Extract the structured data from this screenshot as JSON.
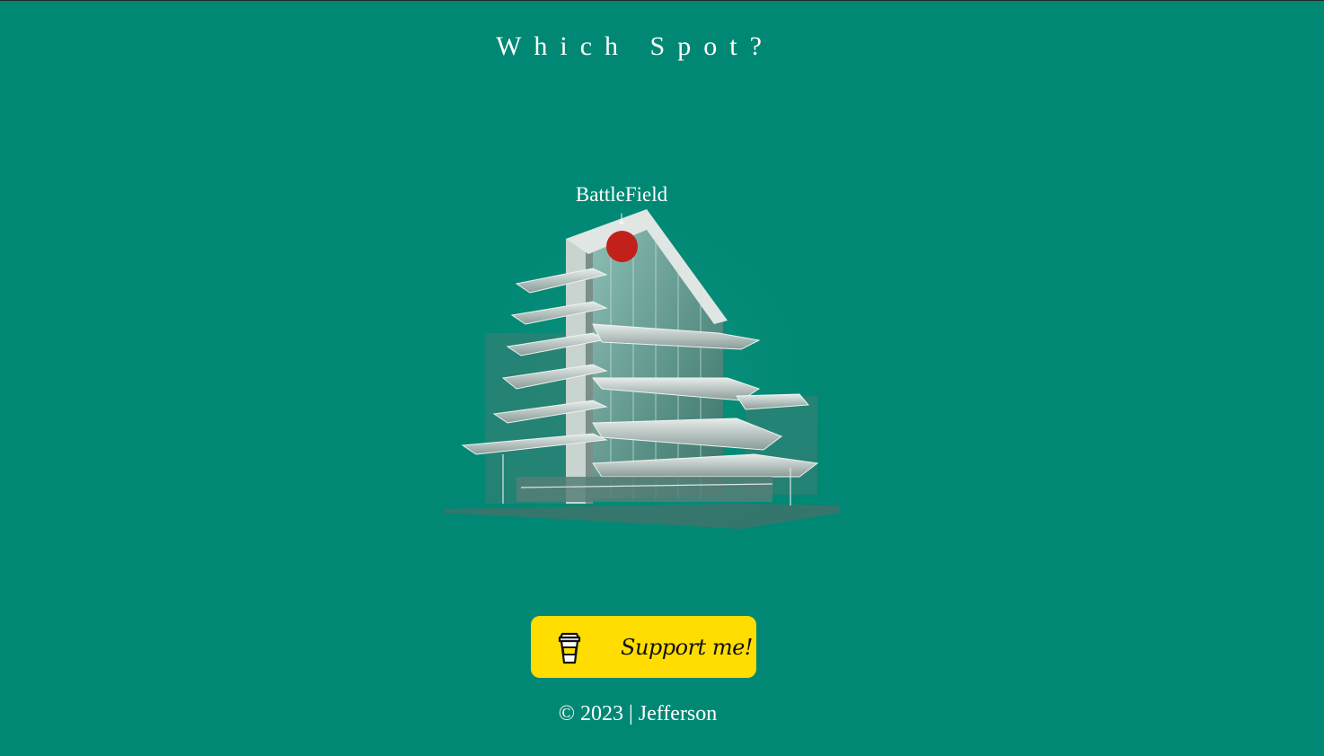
{
  "page": {
    "title": "Which Spot?"
  },
  "scene": {
    "image": "building-sketch",
    "spot": {
      "label": "BattleField",
      "arrow": "↓",
      "marker_color": "#c2201a"
    }
  },
  "support_button": {
    "label": "Support me!",
    "icon": "coffee-cup-icon",
    "color": "#ffdd00"
  },
  "footer": {
    "text": "© 2023 | Jefferson"
  },
  "colors": {
    "background": "#008874",
    "text": "#ffffff"
  }
}
